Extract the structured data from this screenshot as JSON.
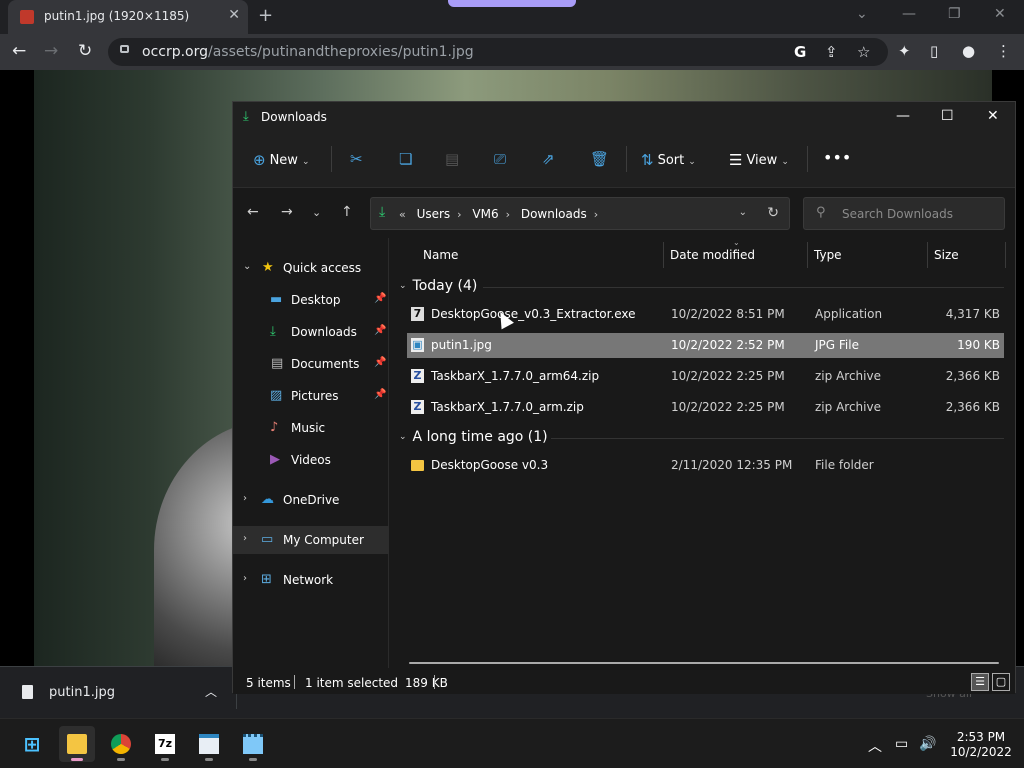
{
  "browser": {
    "tab_title": "putin1.jpg (1920×1185)",
    "url_domain": "occrp.org",
    "url_path": "/assets/putinandtheproxies/putin1.jpg",
    "accent_color": "#a89cf7"
  },
  "download_bar": {
    "file_name": "putin1.jpg",
    "show_all_label": "Show all"
  },
  "explorer": {
    "title": "Downloads",
    "commands": {
      "new_label": "New",
      "sort_label": "Sort",
      "view_label": "View"
    },
    "address": {
      "crumbs": [
        "Users",
        "VM6",
        "Downloads"
      ]
    },
    "search": {
      "placeholder": "Search Downloads"
    },
    "nav": {
      "quick_access": "Quick access",
      "items": [
        "Desktop",
        "Downloads",
        "Documents",
        "Pictures",
        "Music",
        "Videos"
      ],
      "onedrive": "OneDrive",
      "my_computer": "My Computer",
      "network": "Network"
    },
    "columns": {
      "name": "Name",
      "date": "Date modified",
      "type": "Type",
      "size": "Size"
    },
    "groups": [
      {
        "label": "Today (4)",
        "files": [
          {
            "name": "DesktopGoose_v0.3_Extractor.exe",
            "date": "10/2/2022 8:51 PM",
            "type": "Application",
            "size": "4,317 KB"
          },
          {
            "name": "putin1.jpg",
            "date": "10/2/2022 2:52 PM",
            "type": "JPG File",
            "size": "190 KB"
          },
          {
            "name": "TaskbarX_1.7.7.0_arm64.zip",
            "date": "10/2/2022 2:25 PM",
            "type": "zip Archive",
            "size": "2,366 KB"
          },
          {
            "name": "TaskbarX_1.7.7.0_arm.zip",
            "date": "10/2/2022 2:25 PM",
            "type": "zip Archive",
            "size": "2,366 KB"
          }
        ]
      },
      {
        "label": "A long time ago (1)",
        "files": [
          {
            "name": "DesktopGoose v0.3",
            "date": "2/11/2020 12:35 PM",
            "type": "File folder",
            "size": ""
          }
        ]
      }
    ],
    "status": {
      "items": "5 items",
      "selected": "1 item selected",
      "size": "189 KB"
    }
  },
  "taskbar": {
    "sevenzip_label": "7z",
    "time": "2:53 PM",
    "date": "10/2/2022"
  }
}
